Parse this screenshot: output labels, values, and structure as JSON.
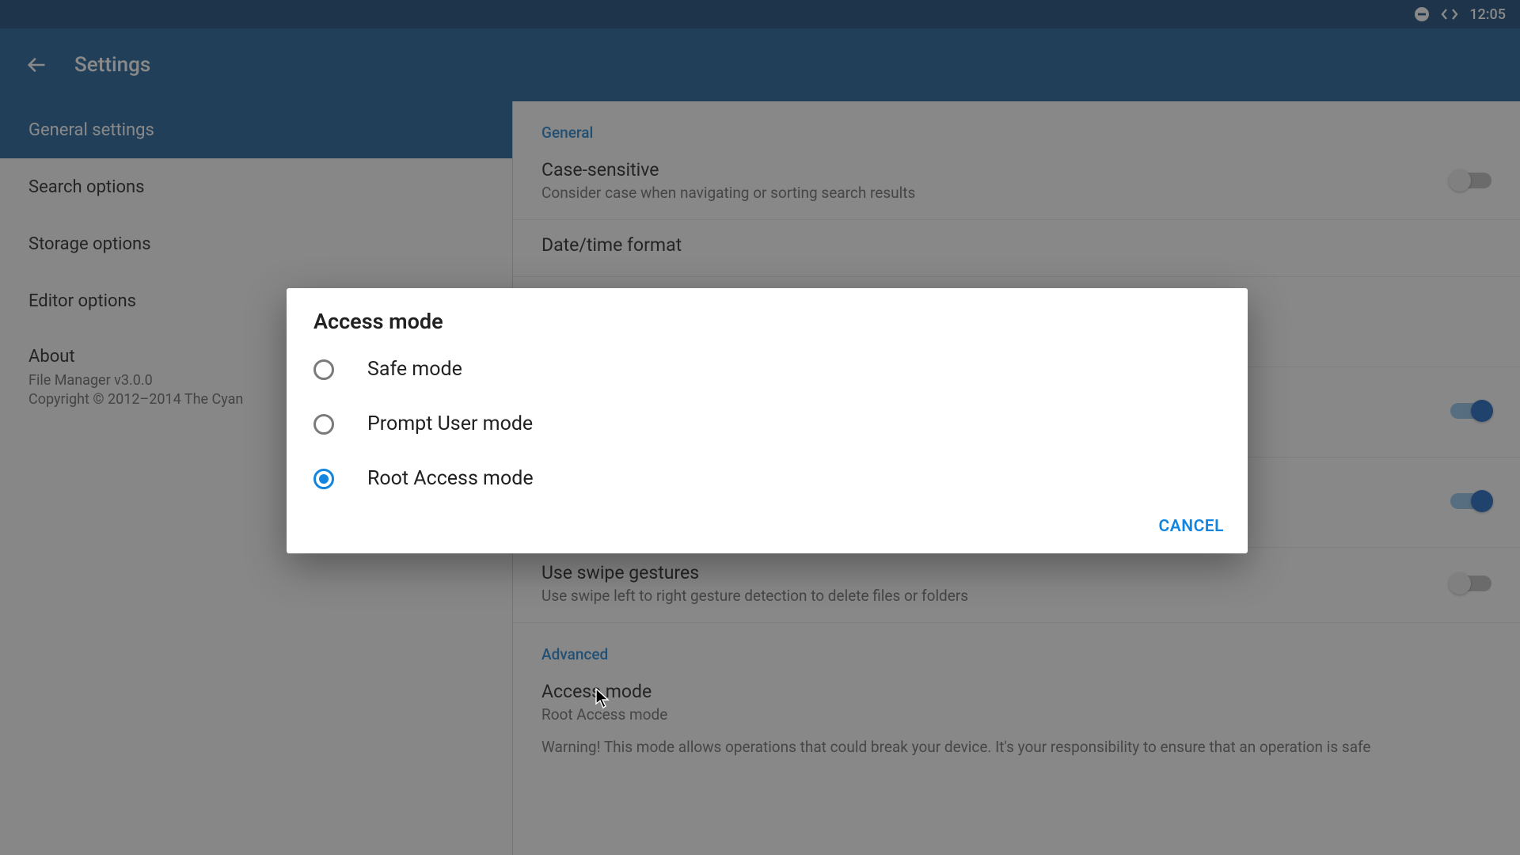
{
  "statusbar": {
    "time": "12:05"
  },
  "appbar": {
    "title": "Settings"
  },
  "sidebar": {
    "items": [
      {
        "label": "General settings",
        "selected": true
      },
      {
        "label": "Search options",
        "selected": false
      },
      {
        "label": "Storage options",
        "selected": false
      },
      {
        "label": "Editor options",
        "selected": false
      }
    ],
    "about": {
      "title": "About",
      "version": "File Manager v3.0.0",
      "copyright": "Copyright © 2012–2014 The Cyan"
    }
  },
  "main": {
    "section_general": "General",
    "section_advanced": "Advanced",
    "case_sensitive": {
      "title": "Case-sensitive",
      "sub": "Consider case when navigating or sorting search results",
      "on": false
    },
    "datetime": {
      "title": "Date/time format"
    },
    "row4": {
      "on": true
    },
    "row5": {
      "on": true
    },
    "swipe": {
      "title": "Use swipe gestures",
      "sub": "Use swipe left to right gesture detection to delete files or folders",
      "on": false
    },
    "access_mode": {
      "title": "Access mode",
      "sub": "Root Access mode",
      "warn": "Warning! This mode allows operations that could break your device. It's your responsibility to ensure that an operation is safe"
    }
  },
  "dialog": {
    "title": "Access mode",
    "options": [
      {
        "label": "Safe mode",
        "checked": false
      },
      {
        "label": "Prompt User mode",
        "checked": false
      },
      {
        "label": "Root Access mode",
        "checked": true
      }
    ],
    "cancel": "CANCEL"
  }
}
